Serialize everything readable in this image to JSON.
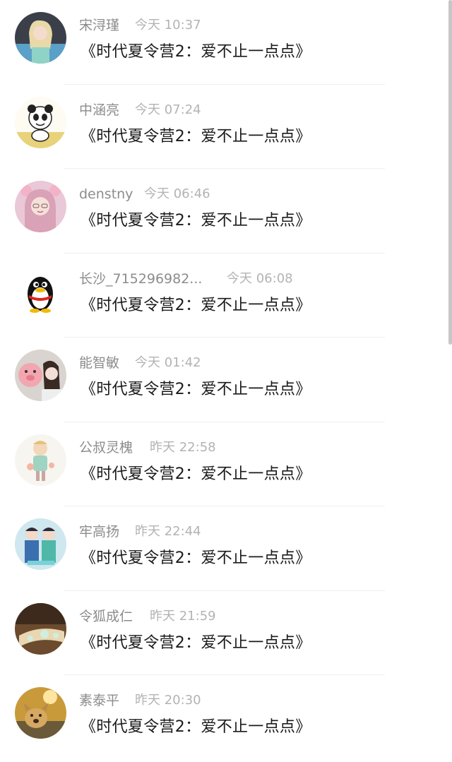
{
  "comments": [
    {
      "name": "宋浔瑾",
      "time": "今天 10:37",
      "text": "《时代夏令营2：爱不止一点点》",
      "avatar_icon": "girl-photo-avatar"
    },
    {
      "name": "中涵亮",
      "time": "今天 07:24",
      "text": "《时代夏令营2：爱不止一点点》",
      "avatar_icon": "panda-cartoon-avatar"
    },
    {
      "name": "denstny",
      "time": "今天 06:46",
      "text": "《时代夏令营2：爱不止一点点》",
      "avatar_icon": "girl-pink-avatar"
    },
    {
      "name": "长沙_715296982...",
      "time": "今天 06:08",
      "text": "《时代夏令营2：爱不止一点点》",
      "avatar_icon": "qq-penguin-avatar"
    },
    {
      "name": "能智敏",
      "time": "今天 01:42",
      "text": "《时代夏令营2：爱不止一点点》",
      "avatar_icon": "girl-pig-avatar"
    },
    {
      "name": "公叔灵槐",
      "time": "昨天 22:58",
      "text": "《时代夏令营2：爱不止一点点》",
      "avatar_icon": "illustration-avatar"
    },
    {
      "name": "牢高扬",
      "time": "昨天 22:44",
      "text": "《时代夏令营2：爱不止一点点》",
      "avatar_icon": "couple-cartoon-avatar"
    },
    {
      "name": "令狐成仁",
      "time": "昨天 21:59",
      "text": "《时代夏令营2：爱不止一点点》",
      "avatar_icon": "bracelet-photo-avatar"
    },
    {
      "name": "素泰平",
      "time": "昨天 20:30",
      "text": "《时代夏令营2：爱不止一点点》",
      "avatar_icon": "dog-sunset-avatar"
    }
  ]
}
